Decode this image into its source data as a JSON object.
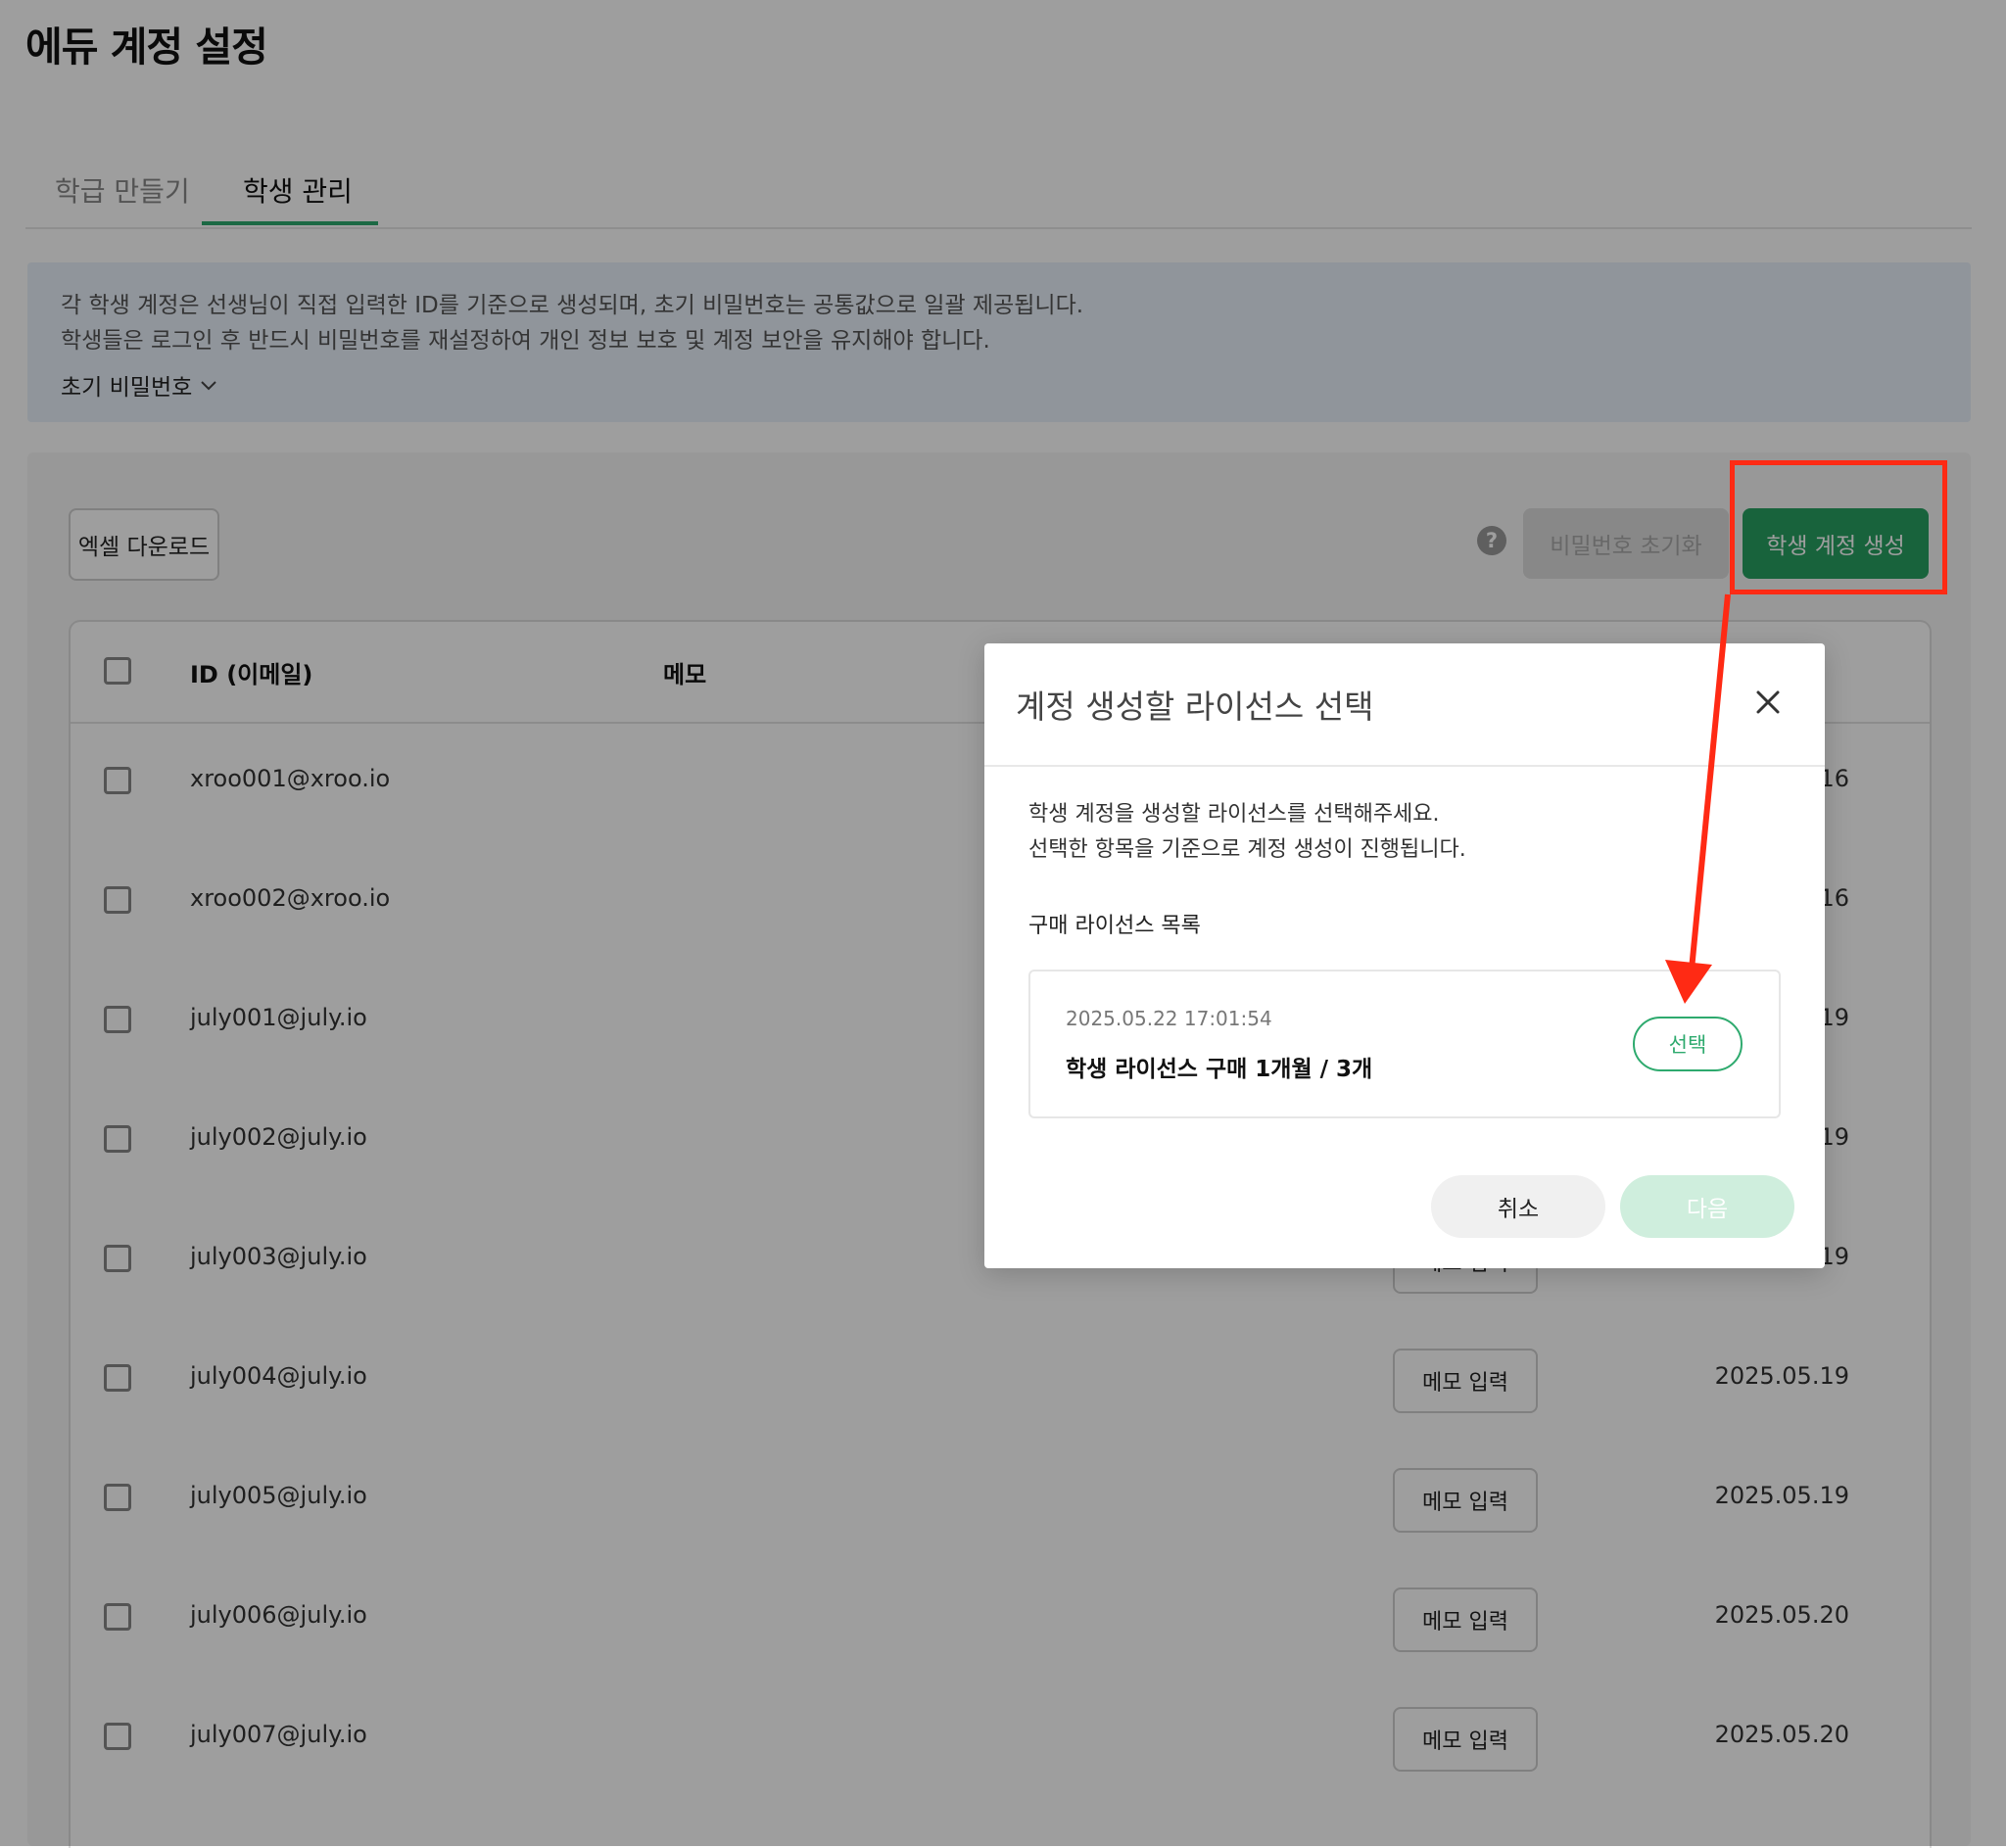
{
  "page": {
    "title": "에듀 계정 설정"
  },
  "tabs": [
    {
      "label": "학급 만들기",
      "active": false
    },
    {
      "label": "학생 관리",
      "active": true
    }
  ],
  "info": {
    "line1": "각 학생 계정은 선생님이 직접 입력한 ID를 기준으로 생성되며, 초기 비밀번호는 공통값으로 일괄 제공됩니다.",
    "line2": "학생들은 로그인 후 반드시 비밀번호를 재설정하여 개인 정보 보호 및 계정 보안을 유지해야 합니다.",
    "toggle_label": "초기 비밀번호"
  },
  "toolbar": {
    "excel_label": "엑셀 다운로드",
    "help_icon": "?",
    "reset_label": "비밀번호 초기화",
    "create_label": "학생 계정 생성"
  },
  "table": {
    "headers": {
      "id": "ID (이메일)",
      "memo": "메모"
    },
    "memo_button_label": "메모 입력",
    "rows": [
      {
        "id": "xroo001@xroo.io",
        "date": "16"
      },
      {
        "id": "xroo002@xroo.io",
        "date": "16"
      },
      {
        "id": "july001@july.io",
        "date": "19"
      },
      {
        "id": "july002@july.io",
        "date": "19"
      },
      {
        "id": "july003@july.io",
        "date": "19"
      },
      {
        "id": "july004@july.io",
        "date": "2025.05.19"
      },
      {
        "id": "july005@july.io",
        "date": "2025.05.19"
      },
      {
        "id": "july006@july.io",
        "date": "2025.05.20"
      },
      {
        "id": "july007@july.io",
        "date": "2025.05.20"
      }
    ]
  },
  "modal": {
    "title": "계정 생성할 라이선스 선택",
    "desc_line1": "학생 계정을 생성할 라이선스를 선택해주세요.",
    "desc_line2": "선택한 항목을 기준으로 계정 생성이 진행됩니다.",
    "section_label": "구매 라이선스 목록",
    "license": {
      "date": "2025.05.22 17:01:54",
      "name": "학생 라이선스 구매 1개월 / 3개",
      "select_label": "선택"
    },
    "cancel_label": "취소",
    "next_label": "다음"
  },
  "colors": {
    "accent_green": "#27a062",
    "annotation_red": "#ff2a14",
    "info_bg": "#e9f0fa"
  }
}
